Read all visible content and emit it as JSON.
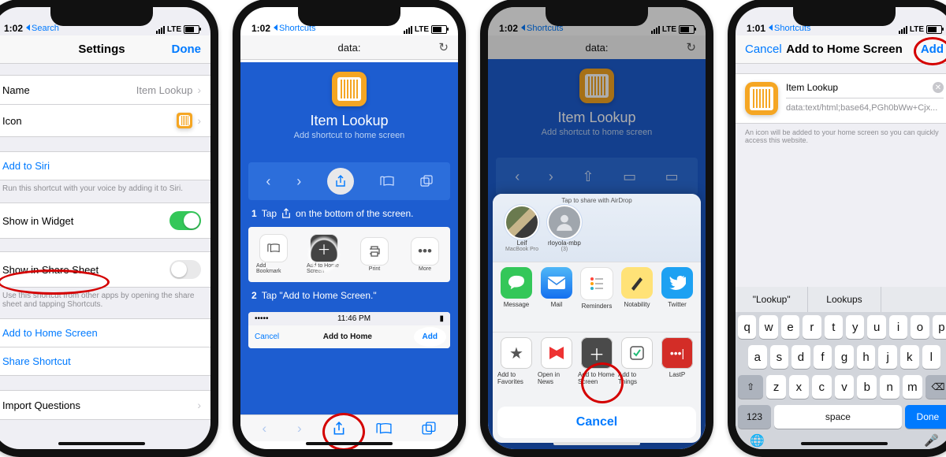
{
  "status": {
    "time": "1:02",
    "time_alt": "1:01",
    "carrier": "LTE",
    "back_search": "Search",
    "back_shortcuts": "Shortcuts"
  },
  "p1": {
    "title": "Settings",
    "done": "Done",
    "name_label": "Name",
    "name_value": "Item Lookup",
    "icon_label": "Icon",
    "siri": "Add to Siri",
    "siri_note": "Run this shortcut with your voice by adding it to Siri.",
    "widget": "Show in Widget",
    "sharesheet": "Show in Share Sheet",
    "sharesheet_note": "Use this shortcut from other apps by opening the share sheet and tapping Shortcuts.",
    "add_home": "Add to Home Screen",
    "share_shortcut": "Share Shortcut",
    "import_q": "Import Questions"
  },
  "p2": {
    "url": "data:",
    "app_title": "Item Lookup",
    "app_sub": "Add shortcut to home screen",
    "step1_a": "Tap",
    "step1_b": "on the bottom of the screen.",
    "step2": "Tap \"Add to Home Screen.\"",
    "mini": {
      "bookmark": "Add Bookmark",
      "home": "Add to Home Screen",
      "print": "Print",
      "more": "More"
    },
    "demo_time": "11:46 PM",
    "demo_cancel": "Cancel",
    "demo_title": "Add to Home",
    "demo_add": "Add"
  },
  "p3": {
    "url": "data:",
    "airdrop_hint": "Tap to share with AirDrop",
    "persons": [
      {
        "name": "Leif",
        "sub": "MacBook Pro"
      },
      {
        "name": "rloyola-mbp",
        "sub": "(3)"
      }
    ],
    "apps": [
      {
        "name": "Message",
        "color": "#34c759",
        "glyph": "message"
      },
      {
        "name": "Mail",
        "color": "#1f9af4",
        "glyph": "mail"
      },
      {
        "name": "Reminders",
        "color": "#ffffff",
        "glyph": "reminders"
      },
      {
        "name": "Notability",
        "color": "#ffdd55",
        "glyph": "notability"
      },
      {
        "name": "Twitter",
        "color": "#1da1f2",
        "glyph": "twitter"
      }
    ],
    "actions": [
      {
        "name": "Add to Favorites",
        "glyph": "star"
      },
      {
        "name": "Open in News",
        "glyph": "news"
      },
      {
        "name": "Add to Home Screen",
        "glyph": "plus"
      },
      {
        "name": "Add to Things",
        "glyph": "check"
      },
      {
        "name": "LastP",
        "glyph": "dots"
      }
    ],
    "cancel": "Cancel"
  },
  "p4": {
    "cancel": "Cancel",
    "title": "Add to Home Screen",
    "add": "Add",
    "name_value": "Item Lookup",
    "url_value": "data:text/html;base64,PGh0bWw+Cjx...",
    "note": "An icon will be added to your home screen so you can quickly access this website.",
    "suggestions": [
      "\"Lookup\"",
      "Lookups",
      ""
    ],
    "keys_r1": [
      "q",
      "w",
      "e",
      "r",
      "t",
      "y",
      "u",
      "i",
      "o",
      "p"
    ],
    "keys_r2": [
      "a",
      "s",
      "d",
      "f",
      "g",
      "h",
      "j",
      "k",
      "l"
    ],
    "keys_r3": [
      "z",
      "x",
      "c",
      "v",
      "b",
      "n",
      "m"
    ],
    "shift": "⇧",
    "bksp": "⌫",
    "k123": "123",
    "space": "space",
    "done": "Done",
    "globe": "🌐",
    "mic": "🎤"
  }
}
